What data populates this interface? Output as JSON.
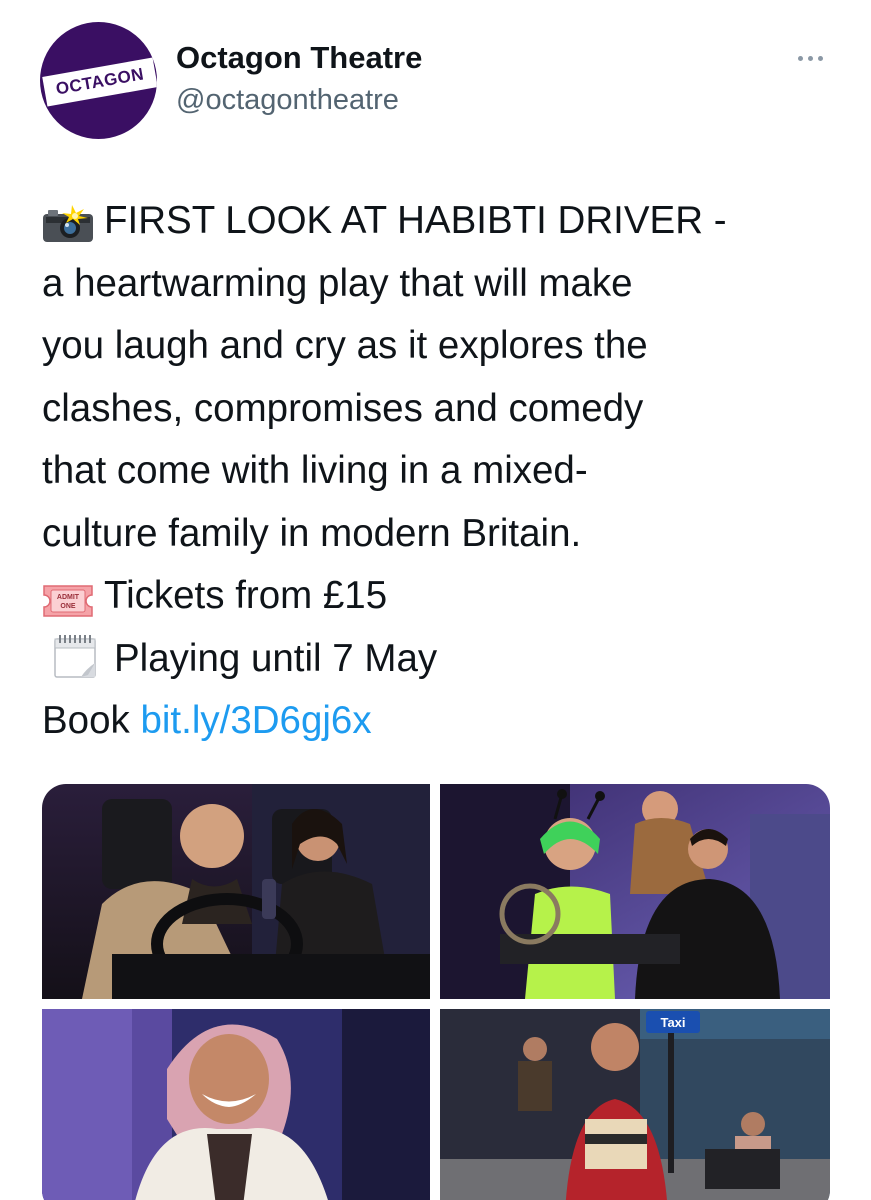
{
  "account": {
    "name": "Octagon Theatre",
    "handle": "@octagontheatre",
    "avatar_logo_text": "OCTAGON",
    "brand_color": "#3a0f63"
  },
  "more_icon": "more-options-icon",
  "tweet": {
    "line1_text": "FIRST LOOK AT HABIBTI DRIVER -",
    "line2": "a heartwarming play that will make",
    "line3": "you laugh and cry as it explores the",
    "line4": "clashes, compromises and comedy",
    "line5": "that come with living in a mixed-",
    "line6": "culture family in modern Britain.",
    "tickets_text": "Tickets from £15",
    "playing_text": "Playing until 7 May",
    "book_label": "Book",
    "link_text": "bit.ly/3D6gj6x",
    "ticket_emoji_text": "ADMIT ONE",
    "link_color": "#1d9bf0"
  },
  "media": {
    "photos": [
      {
        "icon": "stage-photo-car-scene"
      },
      {
        "icon": "stage-photo-alien-costume-scene"
      },
      {
        "icon": "stage-photo-hijab-portrait"
      },
      {
        "icon": "stage-photo-taxi-scene"
      }
    ],
    "taxi_sign": "Taxi"
  }
}
